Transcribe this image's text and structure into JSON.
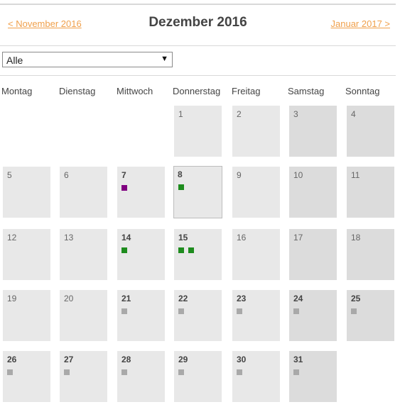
{
  "nav": {
    "prev_label": "< November 2016",
    "title": "Dezember 2016",
    "next_label": "Januar 2017 >"
  },
  "filter": {
    "selected": "Alle"
  },
  "weekdays": [
    "Montag",
    "Dienstag",
    "Mittwoch",
    "Donnerstag",
    "Freitag",
    "Samstag",
    "Sonntag"
  ],
  "colors": {
    "nav_link": "#f0a04b",
    "event_purple": "#800080",
    "event_green": "#1e8c1e",
    "event_gray": "#a9a9a9"
  },
  "weeks": [
    [
      null,
      null,
      null,
      {
        "day": "1",
        "bold": false,
        "events": []
      },
      {
        "day": "2",
        "bold": false,
        "events": []
      },
      {
        "day": "3",
        "bold": false,
        "events": []
      },
      {
        "day": "4",
        "bold": false,
        "events": []
      }
    ],
    [
      {
        "day": "5",
        "bold": false,
        "events": []
      },
      {
        "day": "6",
        "bold": false,
        "events": []
      },
      {
        "day": "7",
        "bold": true,
        "events": [
          "purple"
        ]
      },
      {
        "day": "8",
        "bold": true,
        "today": true,
        "events": [
          "green"
        ]
      },
      {
        "day": "9",
        "bold": false,
        "events": []
      },
      {
        "day": "10",
        "bold": false,
        "events": []
      },
      {
        "day": "11",
        "bold": false,
        "events": []
      }
    ],
    [
      {
        "day": "12",
        "bold": false,
        "events": []
      },
      {
        "day": "13",
        "bold": false,
        "events": []
      },
      {
        "day": "14",
        "bold": true,
        "events": [
          "green"
        ]
      },
      {
        "day": "15",
        "bold": true,
        "events": [
          "green",
          "green"
        ]
      },
      {
        "day": "16",
        "bold": false,
        "events": []
      },
      {
        "day": "17",
        "bold": false,
        "events": []
      },
      {
        "day": "18",
        "bold": false,
        "events": []
      }
    ],
    [
      {
        "day": "19",
        "bold": false,
        "events": []
      },
      {
        "day": "20",
        "bold": false,
        "events": []
      },
      {
        "day": "21",
        "bold": true,
        "events": [
          "gray"
        ]
      },
      {
        "day": "22",
        "bold": true,
        "events": [
          "gray"
        ]
      },
      {
        "day": "23",
        "bold": true,
        "events": [
          "gray"
        ]
      },
      {
        "day": "24",
        "bold": true,
        "events": [
          "gray"
        ]
      },
      {
        "day": "25",
        "bold": true,
        "events": [
          "gray"
        ]
      }
    ],
    [
      {
        "day": "26",
        "bold": true,
        "events": [
          "gray"
        ]
      },
      {
        "day": "27",
        "bold": true,
        "events": [
          "gray"
        ]
      },
      {
        "day": "28",
        "bold": true,
        "events": [
          "gray"
        ]
      },
      {
        "day": "29",
        "bold": true,
        "events": [
          "gray"
        ]
      },
      {
        "day": "30",
        "bold": true,
        "events": [
          "gray"
        ]
      },
      {
        "day": "31",
        "bold": true,
        "events": [
          "gray"
        ]
      },
      null
    ]
  ]
}
